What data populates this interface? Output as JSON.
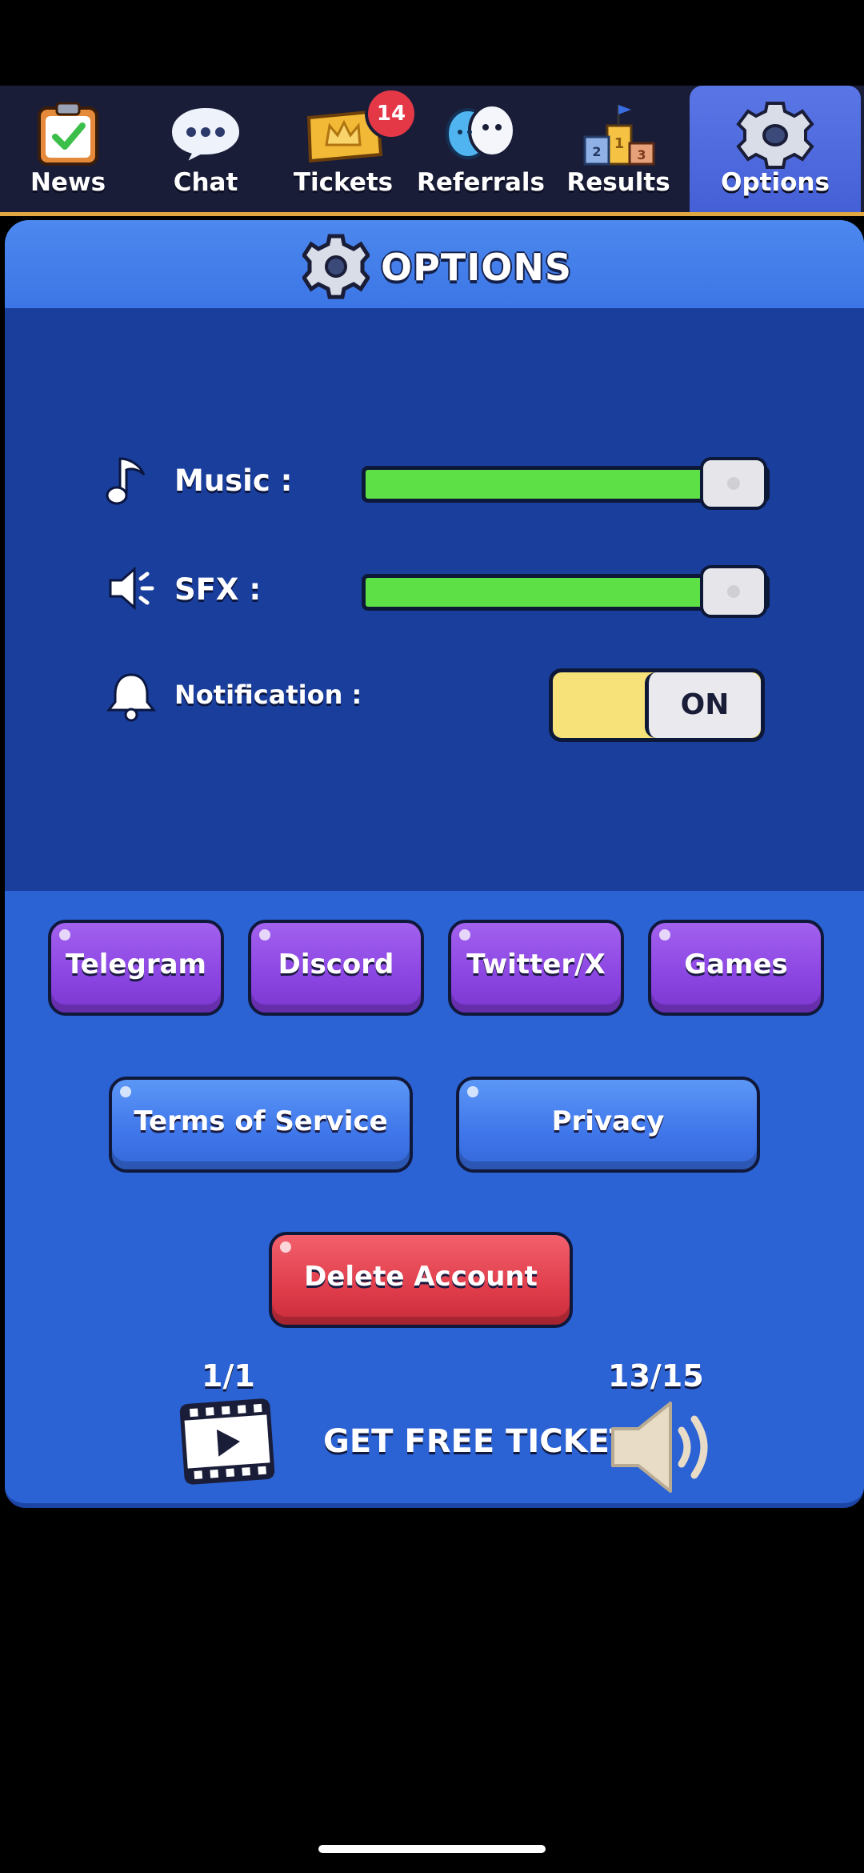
{
  "tabs": [
    {
      "label": "News",
      "icon": "clipboard-check-icon"
    },
    {
      "label": "Chat",
      "icon": "chat-bubble-icon"
    },
    {
      "label": "Tickets",
      "icon": "ticket-icon",
      "badge": "14"
    },
    {
      "label": "Referrals",
      "icon": "friends-icon"
    },
    {
      "label": "Results",
      "icon": "podium-icon"
    },
    {
      "label": "Options",
      "icon": "gear-icon",
      "active": true
    }
  ],
  "panel": {
    "title": "OPTIONS"
  },
  "settings": {
    "music_label": "Music :",
    "music_level": 0.92,
    "sfx_label": "SFX :",
    "sfx_level": 0.92,
    "notification_label": "Notification :",
    "notification_state": "ON"
  },
  "social_buttons": [
    "Telegram",
    "Discord",
    "Twitter/X",
    "Games"
  ],
  "legal_buttons": {
    "terms": "Terms of Service",
    "privacy": "Privacy"
  },
  "delete_account": "Delete Account",
  "free_tickets": {
    "label": "GET FREE TICKETS",
    "video_count": "1/1",
    "audio_count": "13/15"
  },
  "colors": {
    "panel_blue": "#2b62d4",
    "settings_blue": "#1a3e9c",
    "slider_green": "#5de045",
    "toggle_yellow": "#f7e27a",
    "social_purple": "#8b45e2",
    "delete_red": "#e03d4b",
    "tab_accent": "#e1a740"
  }
}
